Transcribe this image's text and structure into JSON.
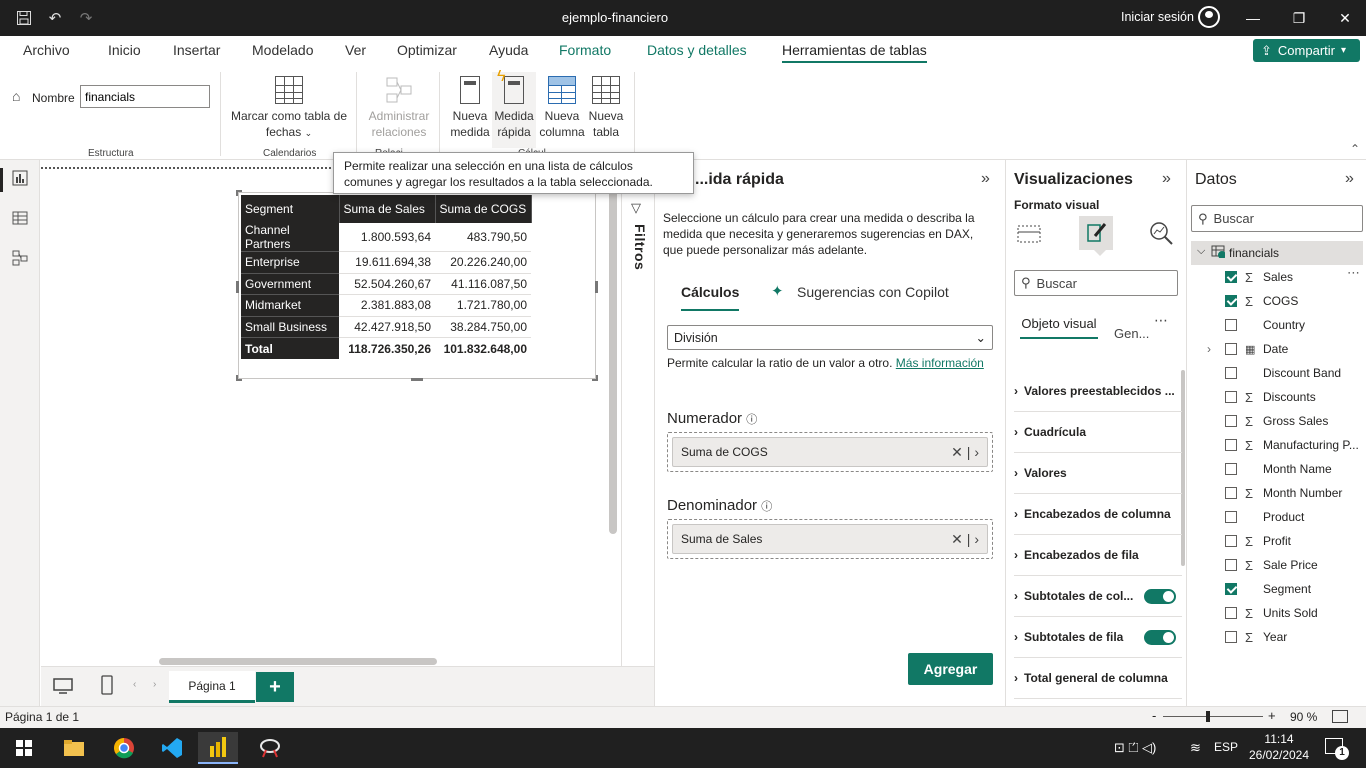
{
  "window": {
    "title": "ejemplo-financiero",
    "signin": "Iniciar sesión"
  },
  "menu": [
    "Archivo",
    "Inicio",
    "Insertar",
    "Modelado",
    "Ver",
    "Optimizar",
    "Ayuda",
    "Formato",
    "Datos y detalles",
    "Herramientas de tablas"
  ],
  "share": {
    "label": "Compartir"
  },
  "ribbon": {
    "name_label": "Nombre",
    "name_value": "financials",
    "estructura": "Estructura",
    "mark_date": "Marcar como tabla de fechas",
    "calendarios": "Calendarios",
    "admin_rel": "Administrar relaciones",
    "relaciones": "Relaci...",
    "nueva_medida": "Nueva medida",
    "medida_rapida": "Medida rápida",
    "nueva_columna": "Nueva columna",
    "nueva_tabla": "Nueva tabla",
    "calculos": "Cálcul..."
  },
  "tooltip": "Permite realizar una selección en una lista de cálculos comunes y agregar los resultados a la tabla seleccionada.",
  "matrix": {
    "headers": [
      "Segment",
      "Suma de Sales",
      "Suma de COGS"
    ],
    "rows": [
      [
        "Channel Partners",
        "1.800.593,64",
        "483.790,50"
      ],
      [
        "Enterprise",
        "19.611.694,38",
        "20.226.240,00"
      ],
      [
        "Government",
        "52.504.260,67",
        "41.116.087,50"
      ],
      [
        "Midmarket",
        "2.381.883,08",
        "1.721.780,00"
      ],
      [
        "Small Business",
        "42.427.918,50",
        "38.284.750,00"
      ]
    ],
    "total": [
      "Total",
      "118.726.350,26",
      "101.832.648,00"
    ]
  },
  "filtros": "Filtros",
  "quick_measure": {
    "title": "...ida rápida",
    "description": "Seleccione un cálculo para crear una medida o describa la medida que necesita y generaremos sugerencias en DAX, que puede personalizar más adelante.",
    "tab_calculos": "Cálculos",
    "tab_copilot": "Sugerencias con Copilot",
    "calc_select": "División",
    "calc_desc": "Permite calcular la ratio de un valor a otro.",
    "more_info": "Más información",
    "numerator_label": "Numerador",
    "numerator_value": "Suma de COGS",
    "denominator_label": "Denominador",
    "denominator_value": "Suma de Sales",
    "add_button": "Agregar"
  },
  "visualizations": {
    "title": "Visualizaciones",
    "format_label": "Formato visual",
    "search_placeholder": "Buscar",
    "tab_object": "Objeto visual",
    "tab_general": "Gen...",
    "sections": [
      "Valores preestablecidos ...",
      "Cuadrícula",
      "Valores",
      "Encabezados de columna",
      "Encabezados de fila",
      "Subtotales de col...",
      "Subtotales de fila",
      "Total general de columna"
    ]
  },
  "data": {
    "title": "Datos",
    "search_placeholder": "Buscar",
    "table_name": "financials",
    "fields": [
      {
        "name": "Sales",
        "checked": true,
        "sigma": true
      },
      {
        "name": "COGS",
        "checked": true,
        "sigma": true
      },
      {
        "name": "Country",
        "checked": false,
        "sigma": false
      },
      {
        "name": "Date",
        "checked": false,
        "sigma": false
      },
      {
        "name": "Discount Band",
        "checked": false,
        "sigma": false
      },
      {
        "name": "Discounts",
        "checked": false,
        "sigma": true
      },
      {
        "name": "Gross Sales",
        "checked": false,
        "sigma": true
      },
      {
        "name": "Manufacturing P...",
        "checked": false,
        "sigma": true
      },
      {
        "name": "Month Name",
        "checked": false,
        "sigma": false
      },
      {
        "name": "Month Number",
        "checked": false,
        "sigma": true
      },
      {
        "name": "Product",
        "checked": false,
        "sigma": false
      },
      {
        "name": "Profit",
        "checked": false,
        "sigma": true
      },
      {
        "name": "Sale Price",
        "checked": false,
        "sigma": true
      },
      {
        "name": "Segment",
        "checked": true,
        "sigma": false
      },
      {
        "name": "Units Sold",
        "checked": false,
        "sigma": true
      },
      {
        "name": "Year",
        "checked": false,
        "sigma": true
      }
    ]
  },
  "pages": {
    "tab": "Página 1",
    "status": "Página 1 de 1",
    "zoom": "90 %"
  },
  "taskbar": {
    "lang": "ESP",
    "time": "11:14",
    "date": "26/02/2024",
    "notif": "1"
  },
  "colors": {
    "accent": "#117865",
    "dark": "#252423"
  }
}
